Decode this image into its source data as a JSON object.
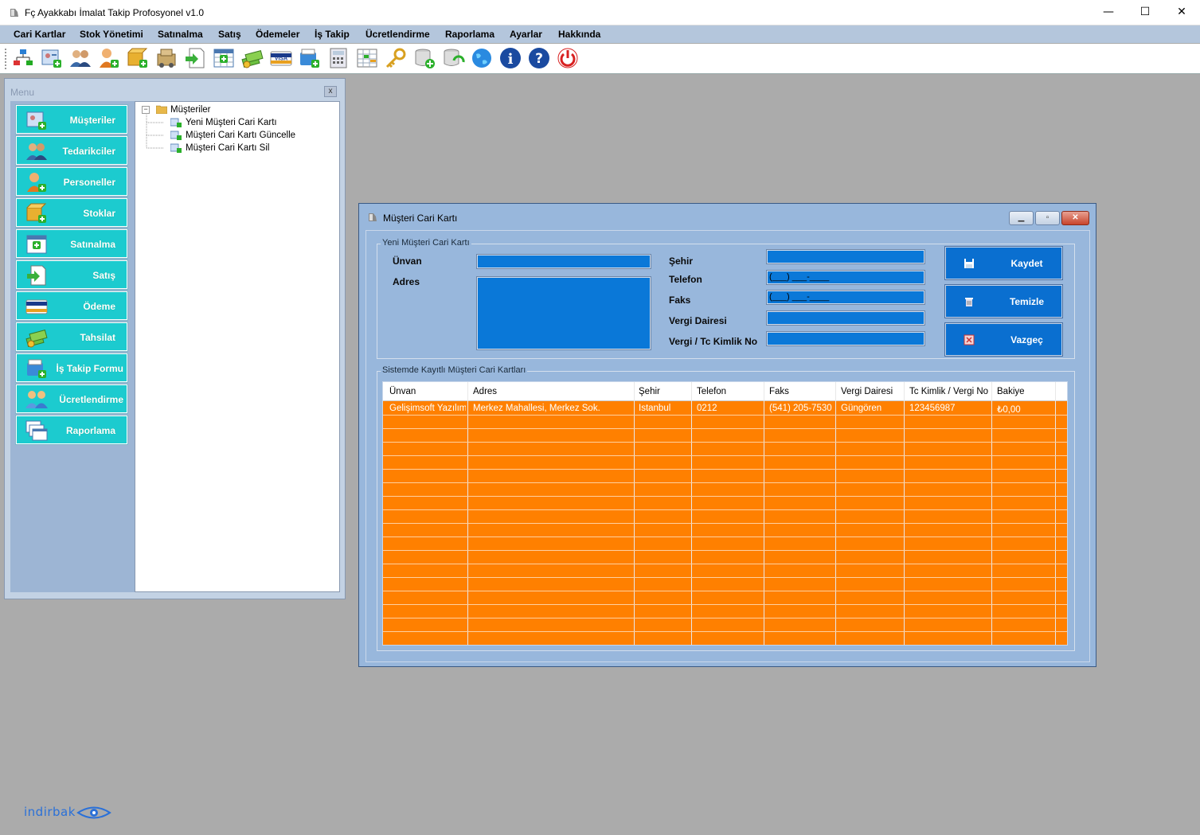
{
  "window": {
    "title": "Fç Ayakkabı İmalat Takip Profosyonel v1.0",
    "minimize": "—",
    "maximize": "☐",
    "close": "✕"
  },
  "menubar": [
    "Cari Kartlar",
    "Stok Yönetimi",
    "Satınalma",
    "Satış",
    "Ödemeler",
    "İş Takip",
    "Ücretlendirme",
    "Raporlama",
    "Ayarlar",
    "Hakkında"
  ],
  "toolbar_icons": [
    "org-chart-icon",
    "customer-card-add-icon",
    "suppliers-icon",
    "personnel-add-icon",
    "stock-add-icon",
    "boxes-icon",
    "sales-doc-icon",
    "purchase-calendar-icon",
    "payment-collect-icon",
    "visa-card-icon",
    "job-tracking-icon",
    "calculator-icon",
    "grid-report-icon",
    "key-icon",
    "database-add-icon",
    "database-sync-icon",
    "globe-icon",
    "info-icon",
    "help-icon",
    "power-icon"
  ],
  "menu_panel": {
    "title": "Menu",
    "close": "x",
    "nav": [
      {
        "label": "Müşteriler",
        "icon": "customer-card-icon"
      },
      {
        "label": "Tedarikciler",
        "icon": "suppliers-icon"
      },
      {
        "label": "Personeller",
        "icon": "personnel-icon"
      },
      {
        "label": "Stoklar",
        "icon": "stock-icon"
      },
      {
        "label": "Satınalma",
        "icon": "purchase-calendar-icon"
      },
      {
        "label": "Satış",
        "icon": "sales-doc-icon"
      },
      {
        "label": "Ödeme",
        "icon": "visa-card-icon"
      },
      {
        "label": "Tahsilat",
        "icon": "money-icon"
      },
      {
        "label": "İş Takip Formu",
        "icon": "job-tracking-icon"
      },
      {
        "label": "Ücretlendirme",
        "icon": "people-icon"
      },
      {
        "label": "Raporlama",
        "icon": "report-windows-icon"
      }
    ],
    "tree": {
      "root": "Müşteriler",
      "expander": "−",
      "children": [
        "Yeni Müşteri Cari Kartı",
        "Müşteri Cari Kartı Güncelle",
        "Müşteri Cari Kartı Sil"
      ]
    }
  },
  "dialog": {
    "title": "Müşteri Cari Kartı",
    "new_group_title": "Yeni Müşteri Cari Kartı",
    "labels": {
      "unvan": "Ünvan",
      "adres": "Adres",
      "sehir": "Şehir",
      "telefon": "Telefon",
      "faks": "Faks",
      "vergi_dairesi": "Vergi Dairesi",
      "vergi_tc": "Vergi / Tc Kimlik No"
    },
    "fields": {
      "unvan": "",
      "adres": "",
      "sehir": "",
      "telefon_mask": "(___) ___-____",
      "faks_mask": "(___) ___-____",
      "vergi_dairesi": "",
      "vergi_tc": ""
    },
    "buttons": {
      "save": "Kaydet",
      "clear": "Temizle",
      "cancel": "Vazgeç"
    },
    "list_group_title": "Sistemde Kayıtlı Müşteri Cari Kartları",
    "columns": [
      "Ünvan",
      "Adres",
      "Şehir",
      "Telefon",
      "Faks",
      "Vergi Dairesi",
      "Tc Kimlik / Vergi No",
      "Bakiye"
    ],
    "rows": [
      [
        "Gelişimsoft Yazılım ...",
        "Merkez Mahallesi, Merkez Sok.",
        "İstanbul",
        "0212",
        "(541) 205-7530",
        "Güngören",
        "123456987",
        "₺0,00"
      ]
    ]
  },
  "watermark": "indirbak",
  "colors": {
    "accent_teal": "#1ccbcf",
    "input_blue": "#0a78d8",
    "grid_orange": "#ff8000",
    "dialog_bg": "#98b7dc"
  }
}
